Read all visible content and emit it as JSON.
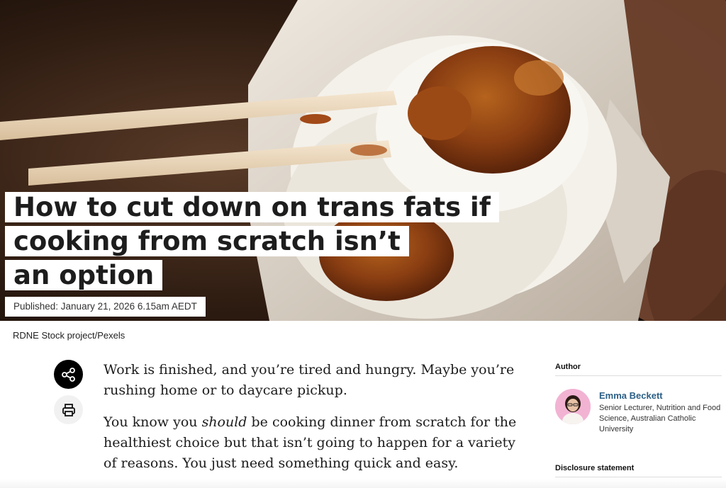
{
  "article": {
    "title": "How to cut down on trans fats if cooking from scratch isn’t an option",
    "title_lines": [
      "How to cut down on trans fats if",
      "cooking from scratch isn’t",
      "an option"
    ],
    "published": "Published: January 21, 2026 6.15am AEDT",
    "image_credit": "RDNE Stock project/Pexels",
    "paragraph1": "Work is finished, and you’re tired and hungry. Maybe you’re rushing home or to daycare pickup.",
    "paragraph2_before": "You know you ",
    "paragraph2_emphasis": "should",
    "paragraph2_after": " be cooking dinner from scratch for the healthiest choice but that isn’t going to happen for a variety of reasons. You just need something quick and easy."
  },
  "actions": {
    "share_icon": "share-icon",
    "print_icon": "printer-icon"
  },
  "sidebar": {
    "author_heading": "Author",
    "author_name": "Emma Beckett",
    "author_role": "Senior Lecturer, Nutrition and Food Science, Australian Catholic University",
    "disclosure_heading": "Disclosure statement"
  },
  "colors": {
    "author_link": "#2b5f86",
    "share_button": "#000000"
  }
}
